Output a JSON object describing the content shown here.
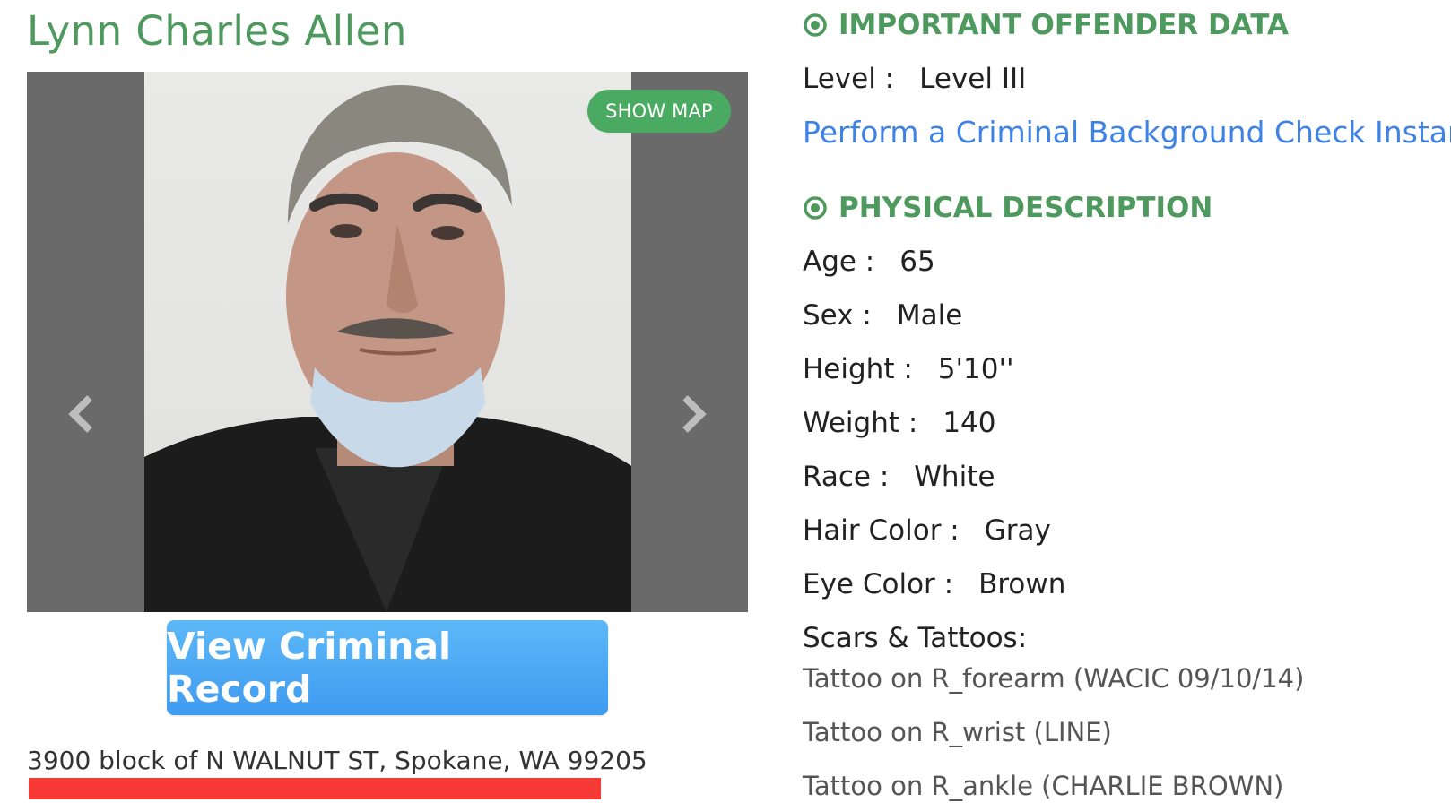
{
  "offender": {
    "name": "Lynn Charles Allen",
    "address": "3900 block of N WALNUT ST, Spokane, WA 99205"
  },
  "photo": {
    "show_map_label": "SHOW MAP",
    "view_record_label": "View Criminal Record"
  },
  "important_data": {
    "heading": "IMPORTANT OFFENDER DATA",
    "level_label": "Level :",
    "level_value": "Level III",
    "background_check_link": "Perform a Criminal Background Check Instantly"
  },
  "physical": {
    "heading": "PHYSICAL DESCRIPTION",
    "fields": [
      {
        "label": "Age :",
        "value": "65"
      },
      {
        "label": "Sex :",
        "value": "Male"
      },
      {
        "label": "Height :",
        "value": "5'10''"
      },
      {
        "label": "Weight :",
        "value": "140"
      },
      {
        "label": "Race :",
        "value": "White"
      },
      {
        "label": "Hair Color :",
        "value": "Gray"
      },
      {
        "label": "Eye Color :",
        "value": "Brown"
      }
    ],
    "scars_label": "Scars & Tattoos:",
    "tattoos": [
      "Tattoo on R_forearm (WACIC 09/10/14)",
      "Tattoo on R_wrist (LINE)",
      "Tattoo on R_ankle (CHARLIE BROWN)"
    ]
  },
  "colors": {
    "accent_green": "#4e9a5e",
    "link_blue": "#3d82e6",
    "button_blue": "#4aa8f4",
    "highlight_red": "#f73a36"
  },
  "icons": {
    "carousel_prev": "chevron-left-icon",
    "carousel_next": "chevron-right-icon",
    "section_marker": "radio-target-icon"
  }
}
